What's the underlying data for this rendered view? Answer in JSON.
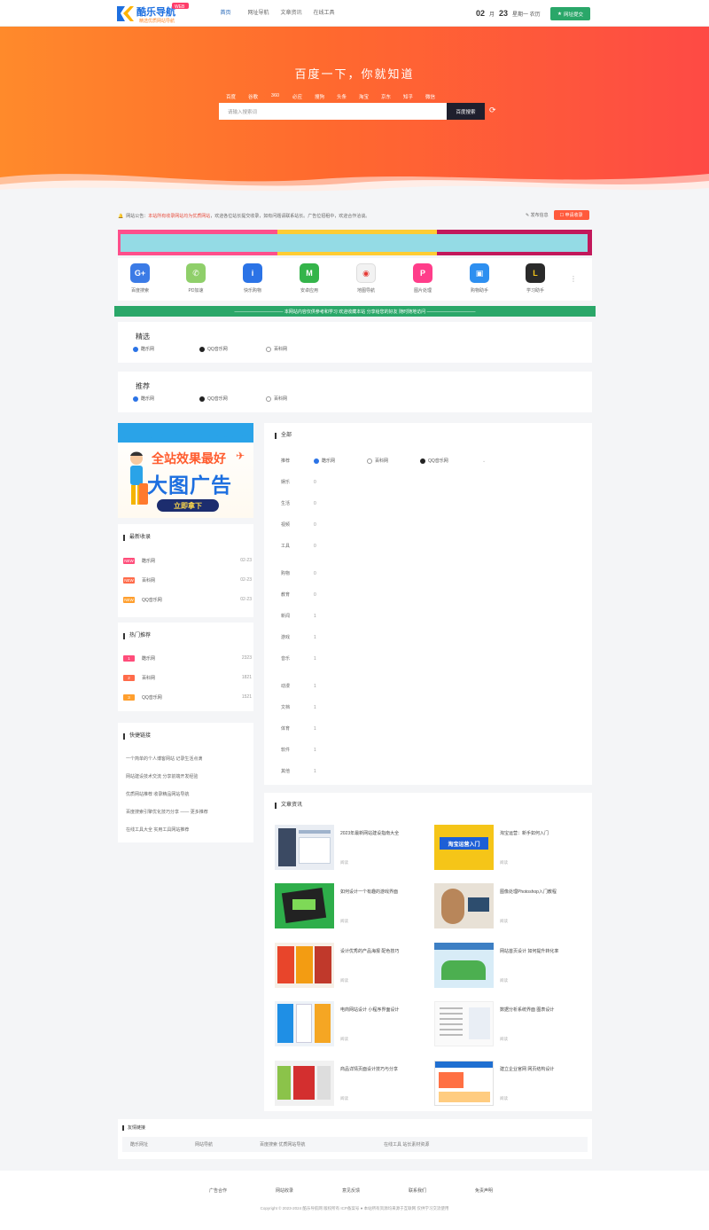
{
  "header": {
    "logo_text": "酷乐导航",
    "logo_tag": "WEB",
    "logo_sub": "精选优质网站导航",
    "nav": [
      "首页",
      "网址导航",
      "文章资讯",
      "在线工具"
    ],
    "date_big_1": "02",
    "date_small_1": "月",
    "date_big_2": "23",
    "date_small_2": "星期一 农历",
    "submit_label": "网址提交"
  },
  "hero": {
    "title": "百度一下，你就知道",
    "engines": [
      "百度",
      "谷歌",
      "360",
      "必应",
      "搜狗",
      "头条",
      "淘宝",
      "京东",
      "知乎",
      "微信"
    ],
    "search_placeholder": "请输入搜索词",
    "search_button": "百度搜索"
  },
  "notice": {
    "label": "网站公告：",
    "highlight": "本站所有收录网站均为优质网站",
    "text": "，欢迎各位站长提交收录，如有问题请联系站长。广告位招租中，欢迎合作洽谈。",
    "post_link": "发布信息",
    "join_button": "申请收录"
  },
  "apps": [
    {
      "label": "百度搜索",
      "color": "#3b7be6",
      "glyph": "G+"
    },
    {
      "label": "PD加速",
      "color": "#8fcf6a",
      "glyph": "✆"
    },
    {
      "label": "快乐购物",
      "color": "#2b73e6",
      "glyph": "i"
    },
    {
      "label": "安卓应用",
      "color": "#34b44a",
      "glyph": "M"
    },
    {
      "label": "地图导航",
      "color": "#f2f2f2",
      "glyph": "◉"
    },
    {
      "label": "图片处理",
      "color": "#ff3d8a",
      "glyph": "P"
    },
    {
      "label": "购物助手",
      "color": "#2d8ff0",
      "glyph": "▣"
    },
    {
      "label": "学习助手",
      "color": "#2a2a2a",
      "glyph": "L"
    }
  ],
  "strip_text": "——————————— 本网站内容仅供参考和学习 欢迎收藏本站 分享给您的好友 随时随地访问 ———————————",
  "panel_1": {
    "title": "精选",
    "links": [
      "酷乐网",
      "QQ音乐网",
      "百科网"
    ]
  },
  "panel_2": {
    "title": "推荐",
    "links": [
      "酷乐网",
      "QQ音乐网",
      "百科网"
    ]
  },
  "ad": {
    "line1": "全站效果最好",
    "line2": "大图广告",
    "button": "立即拿下"
  },
  "new_sites": {
    "title": "最新收录",
    "rows": [
      {
        "tag": "NEW",
        "name": "酷乐网",
        "meta": "02-23",
        "color": "#ff4d7a"
      },
      {
        "tag": "NEW",
        "name": "百科网",
        "meta": "02-23",
        "color": "#ff6b4a"
      },
      {
        "tag": "NEW",
        "name": "QQ音乐网",
        "meta": "02-23",
        "color": "#ff9f2e"
      }
    ]
  },
  "hot_sites": {
    "title": "热门推荐",
    "rows": [
      {
        "tag": "1",
        "name": "酷乐网",
        "meta": "2323",
        "color": "#ff4d7a"
      },
      {
        "tag": "2",
        "name": "百科网",
        "meta": "1821",
        "color": "#ff6b4a"
      },
      {
        "tag": "3",
        "name": "QQ音乐网",
        "meta": "1521",
        "color": "#ff9f2e"
      }
    ]
  },
  "quick": {
    "title": "快捷链接",
    "lines": [
      "一个简单的个人博客网站 记录生活点滴",
      "网站建设技术交流 分享前端开发经验",
      "优质网站推荐 收录精品网站导航",
      "百度搜索引擎优化技巧分享 —— 更多推荐",
      "在线工具大全 实用工具网站推荐"
    ],
    "highlight": "更多推荐"
  },
  "all_sites": {
    "title": "全部",
    "first_label": "推荐",
    "first_links": [
      "酷乐网",
      "百科网",
      "QQ音乐网"
    ],
    "rows": [
      {
        "label": "娱乐",
        "value": "0"
      },
      {
        "label": "生活",
        "value": "0"
      },
      {
        "label": "视频",
        "value": "0"
      },
      {
        "label": "工具",
        "value": "0"
      },
      {
        "label": "购物",
        "value": "0"
      },
      {
        "label": "教育",
        "value": "0"
      },
      {
        "label": "新闻",
        "value": "1"
      },
      {
        "label": "游戏",
        "value": "1"
      },
      {
        "label": "音乐",
        "value": "1"
      },
      {
        "label": "动漫",
        "value": "1"
      },
      {
        "label": "文档",
        "value": "1"
      },
      {
        "label": "体育",
        "value": "1"
      },
      {
        "label": "软件",
        "value": "1"
      },
      {
        "label": "其他",
        "value": "1"
      }
    ]
  },
  "articles": {
    "title": "文章资讯",
    "items": [
      {
        "title": "2023年最新网站建设指南大全",
        "meta": "阅读"
      },
      {
        "title": "淘宝运营：新手如何入门",
        "meta": "阅读"
      },
      {
        "title": "如何设计一个有趣的游戏界面",
        "meta": "阅读"
      },
      {
        "title": "图像处理Photoshop入门教程",
        "meta": "阅读"
      },
      {
        "title": "设计优秀的产品海报 配色技巧",
        "meta": "阅读"
      },
      {
        "title": "网站首页设计 如何提升转化率",
        "meta": "阅读"
      },
      {
        "title": "电商网站设计 小程序界面设计",
        "meta": "阅读"
      },
      {
        "title": "数据分析系统界面 图表设计",
        "meta": "阅读"
      },
      {
        "title": "商品详情页面设计技巧与分享",
        "meta": "阅读"
      },
      {
        "title": "建立企业官网 网页结构设计",
        "meta": "阅读"
      }
    ]
  },
  "friends": {
    "title": "友情链接",
    "links": [
      "酷乐网址",
      "网站导航",
      "百度搜索 优质网站导航",
      "在线工具 站长素材资源"
    ]
  },
  "footer": {
    "links": [
      "广告合作",
      "网站收录",
      "意见反馈",
      "联系我们",
      "免责声明"
    ],
    "copyright": "Copyright © 2023-2024 酷乐导航网 版权所有 ICP备案号 ● 本站所有资源均来源于互联网 仅供学习交流使用"
  }
}
